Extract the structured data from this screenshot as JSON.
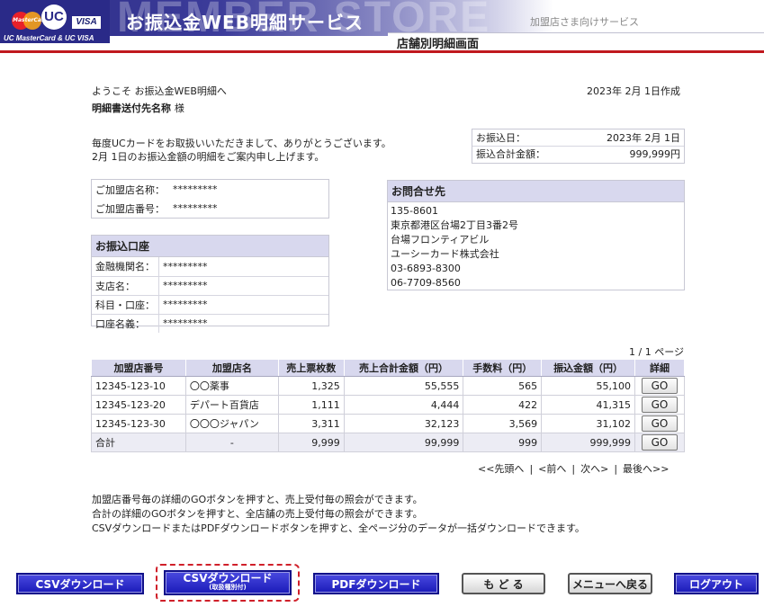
{
  "header": {
    "brand_mc_text": "MasterCard",
    "brand_uc": "UC",
    "brand_visa": "VISA",
    "brand_line": "UC MasterCard & UC VISA",
    "bg_word": "MEMBER STORE",
    "site_title": "お振込金WEB明細サービス",
    "subtitle_right": "加盟店さま向けサービス",
    "page_title": "店舗別明細画面"
  },
  "intro": {
    "welcome": "ようこそ お振込金WEB明細へ",
    "recipient": "明細書送付先名称",
    "recipient_suffix": "様",
    "created_date": "2023年 2月 1日作成",
    "message_line1": "毎度UCカードをお取扱いいただきまして、ありがとうございます。",
    "message_line2": "2月 1日のお振込金額の明細をご案内申し上げます。"
  },
  "summary": {
    "transfer_date_label": "お振込日：",
    "transfer_date_value": "2023年 2月 1日",
    "total_label": "振込合計金額：",
    "total_value": "999,999円"
  },
  "merchant": {
    "name_label": "ご加盟店名称：",
    "name_value": "*********",
    "number_label": "ご加盟店番号：",
    "number_value": "*********"
  },
  "bank": {
    "title": "お振込口座",
    "rows": [
      {
        "label": "金融機関名：",
        "value": "*********"
      },
      {
        "label": "支店名：",
        "value": "*********"
      },
      {
        "label": "科目・口座：",
        "value": "*********"
      },
      {
        "label": "口座名義：",
        "value": "*********"
      }
    ]
  },
  "contact": {
    "title": "お問合せ先",
    "lines": [
      "135-8601",
      "東京都港区台場2丁目3番2号",
      "台場フロンティアビル",
      "ユーシーカード株式会社",
      "03-6893-8300",
      "06-7709-8560"
    ]
  },
  "table": {
    "page_info": "1 / 1 ページ",
    "headers": [
      "加盟店番号",
      "加盟店名",
      "売上票枚数",
      "売上合計金額（円）",
      "手数料（円）",
      "振込金額（円）",
      "詳細"
    ],
    "rows": [
      {
        "number": "12345-123-10",
        "name": "〇〇薬事",
        "count": "1,325",
        "sales": "55,555",
        "fee": "565",
        "transfer": "55,100",
        "go": "GO"
      },
      {
        "number": "12345-123-20",
        "name": "デパート百貨店",
        "count": "1,111",
        "sales": "4,444",
        "fee": "422",
        "transfer": "41,315",
        "go": "GO"
      },
      {
        "number": "12345-123-30",
        "name": "〇〇〇ジャパン",
        "count": "3,311",
        "sales": "32,123",
        "fee": "3,569",
        "transfer": "31,102",
        "go": "GO"
      }
    ],
    "total": {
      "label": "合計",
      "name": "-",
      "count": "9,999",
      "sales": "99,999",
      "fee": "999",
      "transfer": "999,999",
      "go": "GO"
    }
  },
  "pager": {
    "first": "<<先頭へ",
    "prev": "<前へ",
    "next": "次へ>",
    "last": "最後へ>>",
    "separator": "|"
  },
  "notes": [
    "加盟店番号毎の詳細のGOボタンを押すと、売上受付毎の照会ができます。",
    "合計の詳細のGOボタンを押すと、全店舗の売上受付毎の照会ができます。",
    "CSVダウンロードまたはPDFダウンロードボタンを押すと、全ページ分のデータが一括ダウンロードできます。"
  ],
  "buttons": {
    "csv": "CSVダウンロード",
    "csv_type": "CSVダウンロード",
    "csv_type_sub": "(取扱種別付)",
    "pdf": "PDFダウンロード",
    "back": "も ど る",
    "menu": "メニューへ戻る",
    "logout": "ログアウト"
  },
  "colors": {
    "brand_navy": "#2a2a88",
    "accent_red": "#c0181e",
    "header_lavender": "#d8d8ee",
    "button_blue": "#1a1ab8",
    "highlight_dash": "#d0202a"
  }
}
